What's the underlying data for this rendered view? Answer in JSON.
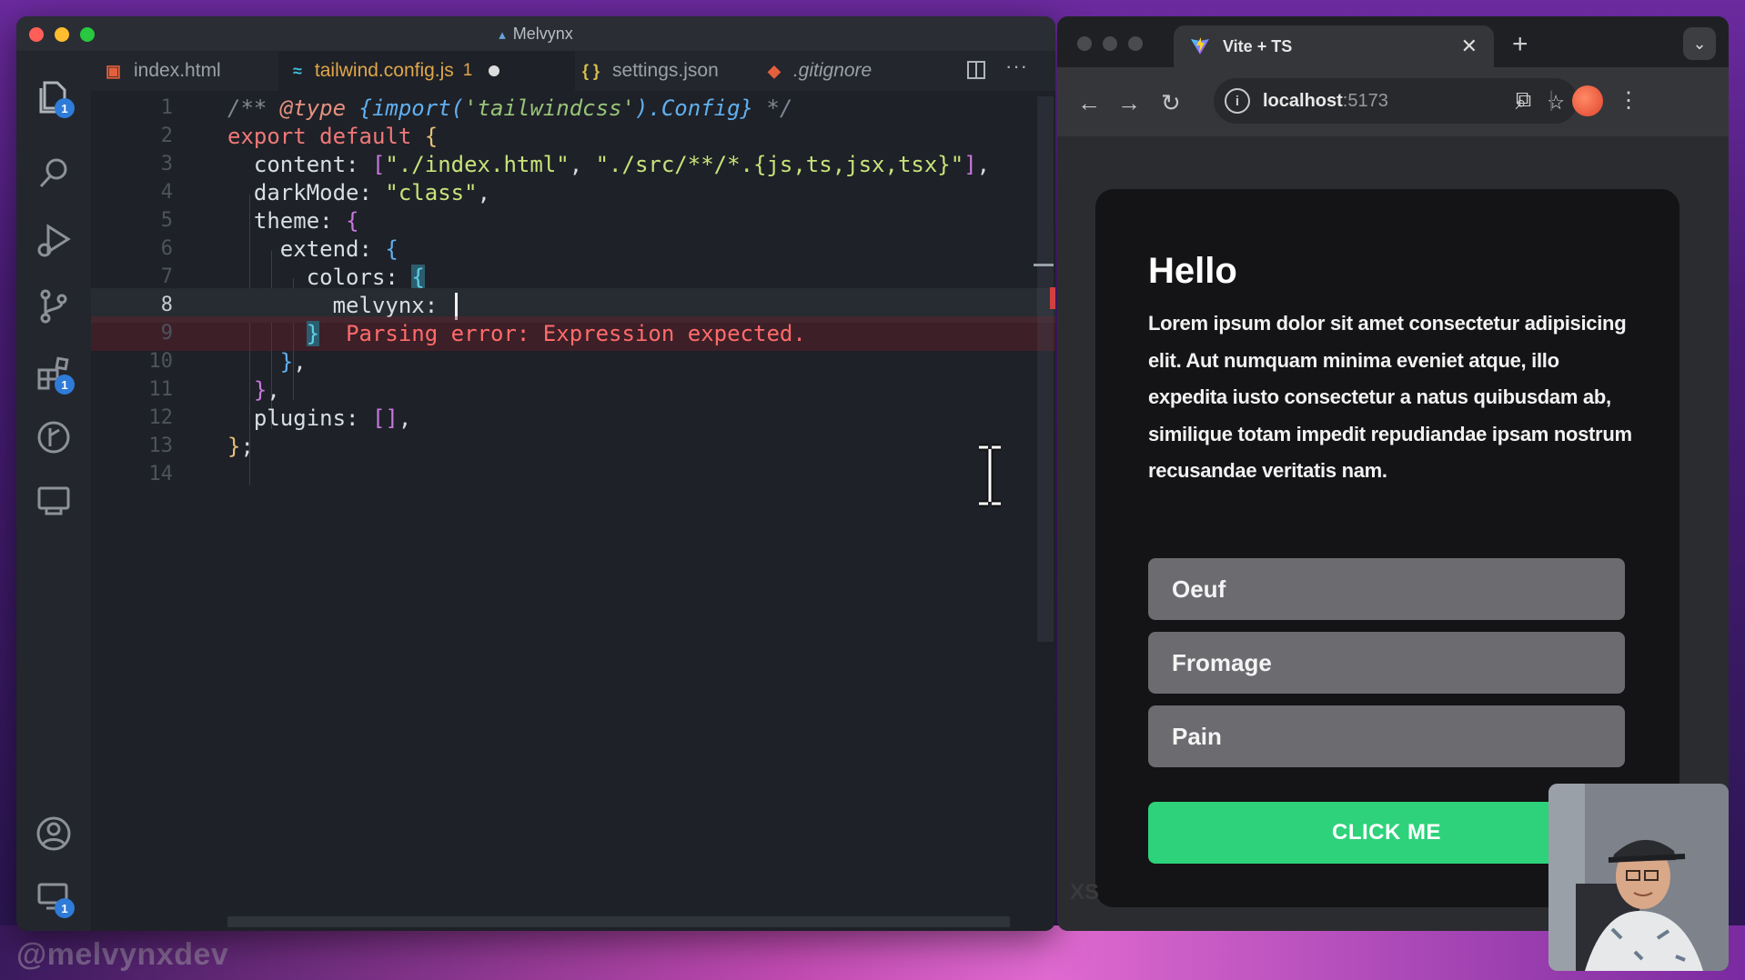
{
  "watermark": "@melvynxdev",
  "vscode": {
    "window_title": "Melvynx",
    "activity_badges": {
      "explorer": "1",
      "extensions": "1",
      "accounts": "1"
    },
    "tabs": [
      {
        "label": "index.html",
        "icon": "html5-icon",
        "active": false
      },
      {
        "label": "tailwind.config.js",
        "icon": "tailwind-icon",
        "active": true,
        "problems": "1",
        "dirty": true
      },
      {
        "label": "settings.json",
        "icon": "json-braces-icon",
        "active": false
      },
      {
        "label": ".gitignore",
        "icon": "git-icon",
        "active": false
      }
    ],
    "line_numbers": [
      "1",
      "2",
      "3",
      "4",
      "5",
      "6",
      "7",
      "8",
      "9",
      "10",
      "11",
      "12",
      "13",
      "14"
    ],
    "current_line": 8,
    "error_message": "Parsing error: Expression expected."
  },
  "browser": {
    "tab_title": "Vite + TS",
    "url_host": "localhost",
    "url_port": ":5173",
    "page": {
      "heading": "Hello",
      "paragraph": "Lorem ipsum dolor sit amet consectetur adipisicing elit. Aut numquam minima eveniet atque, illo expedita iusto consectetur a natus quibusdam ab, similique totam impedit repudiandae ipsam nostrum recusandae veritatis nam.",
      "options": [
        "Oeuf",
        "Fromage",
        "Pain"
      ],
      "button": "CLICK ME",
      "breakpoint_label": "XS"
    }
  },
  "colors": {
    "cta_green": "#2dd27a",
    "option_gray": "#6b6b70",
    "card_bg": "#141416",
    "active_tab_orange": "#e0a64a",
    "error_red": "#ff6b6b"
  }
}
